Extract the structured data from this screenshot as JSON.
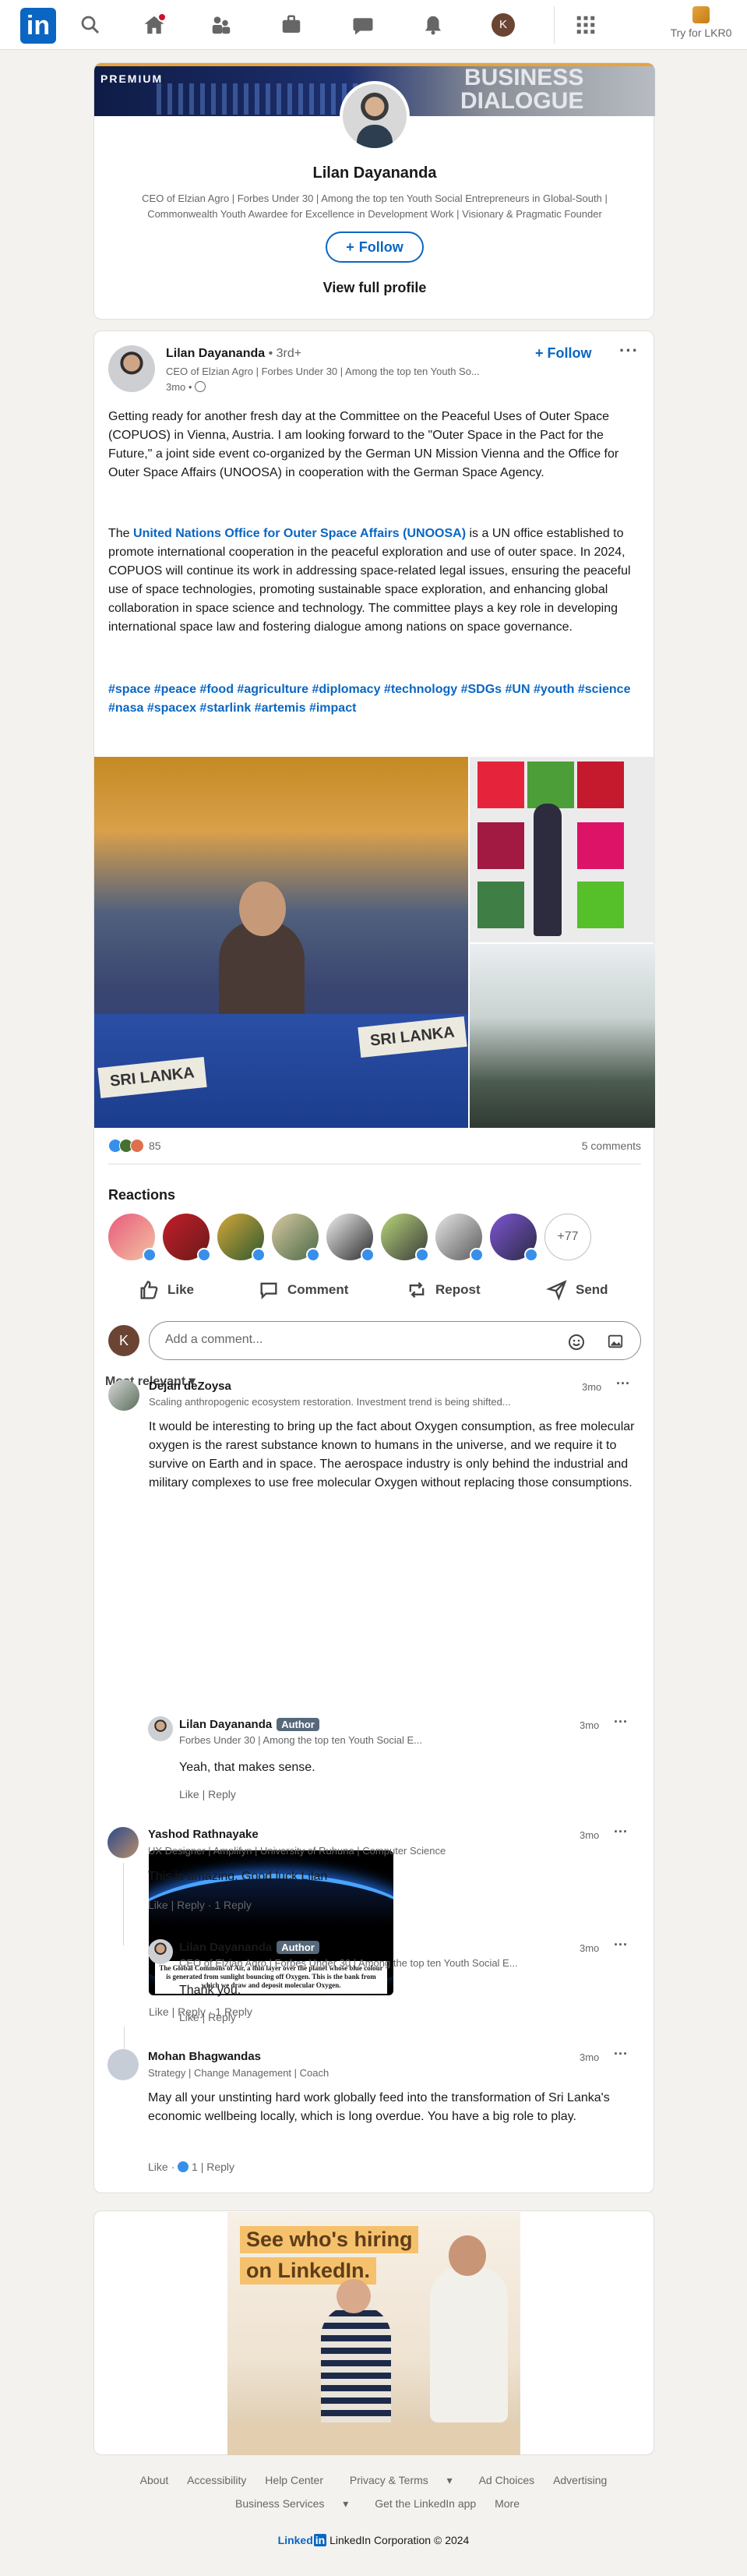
{
  "nav": {
    "logo": "in",
    "try_premium": "Try for LKR0",
    "me_initial": "K"
  },
  "profile_card": {
    "premium_label": "PREMIUM",
    "banner_text_1": "BUSINESS",
    "banner_text_2": "DIALOGUE",
    "name": "Lilan Dayananda",
    "headline": "CEO of Elzian Agro | Forbes Under 30 | Among the top ten Youth Social Entrepreneurs in Global-South | Commonwealth Youth Awardee for Excellence in Development Work | Visionary & Pragmatic Founder",
    "follow": "Follow",
    "view_profile": "View full profile"
  },
  "post": {
    "author": "Lilan Dayananda",
    "degree": "• 3rd+",
    "headline": "CEO of Elzian Agro | Forbes Under 30 | Among the top ten Youth So...",
    "time": "3mo •",
    "follow": "Follow",
    "para1": "Getting ready for another fresh day at the Committee on the Peaceful Uses of Outer Space (COPUOS) in Vienna, Austria. I am looking forward to the \"Outer Space in the Pact for the Future,\" a joint side event co-organized by the German UN Mission Vienna and the Office for Outer Space Affairs (UNOOSA) in cooperation with the German Space Agency.",
    "para2_pre": "The ",
    "para2_link": "United Nations Office for Outer Space Affairs (UNOOSA)",
    "para2_post": " is a UN office established to promote international cooperation in the peaceful exploration and use of outer space. In 2024, COPUOS will continue its work in addressing space-related legal issues, ensuring the peaceful use of space technologies, promoting sustainable space exploration, and enhancing global collaboration in space science and technology. The committee plays a key role in developing international space law and fostering dialogue among nations on space governance.",
    "hashtags": "#space #peace #food #agriculture #diplomacy #technology #SDGs #UN #youth #science #nasa #spacex #starlink #artemis #impact",
    "nameplate_1": "SRI LANKA",
    "nameplate_2": "SRI LANKA",
    "reaction_count": "85",
    "comments_count": "5 comments",
    "reactions_title": "Reactions",
    "more_reactors": "+77",
    "actions": {
      "like": "Like",
      "comment": "Comment",
      "repost": "Repost",
      "send": "Send"
    },
    "comment_placeholder": "Add a comment...",
    "sort": "Most relevant"
  },
  "comments": [
    {
      "name": "Dejan deZoysa",
      "sub": "Scaling anthropogenic ecosystem restoration. Investment trend is being shifted...",
      "time": "3mo",
      "text": "It would be interesting to bring up the fact about Oxygen consumption, as free molecular oxygen is the rarest substance known to humans in the universe, and we require it to survive on Earth and in space. The aerospace industry is only behind the industrial and military complexes to use free molecular Oxygen without replacing those consumptions.",
      "image_caption": "The Global Commons of Air, a thin layer over the planet whose blue colour is generated from sunlight bouncing off Oxygen. This is the bank from which we draw and deposit molecular Oxygen.",
      "like": "Like",
      "reply": "Reply",
      "replies": "1 Reply"
    },
    {
      "name": "Lilan Dayananda",
      "badge": "Author",
      "sub": "Forbes Under 30 | Among the top ten Youth Social E...",
      "time": "3mo",
      "text": "Yeah, that makes sense.",
      "like": "Like",
      "reply": "Reply"
    },
    {
      "name": "Yashod Rathnayake",
      "sub": "UX Designer | Amplifyn | University of Ruhuna | Computer Science",
      "time": "3mo",
      "text": "This is amazing. Good luck Lilan",
      "like": "Like",
      "reply": "Reply",
      "replies": "1 Reply"
    },
    {
      "name": "Lilan Dayananda",
      "badge": "Author",
      "sub": "CEO of Elzian Agro | Forbes Under 30 | Among the top ten Youth Social E...",
      "time": "3mo",
      "text": "Thank you.",
      "like": "Like",
      "reply": "Reply"
    },
    {
      "name": "Mohan Bhagwandas",
      "sub": "Strategy | Change Management | Coach",
      "time": "3mo",
      "text": "May all your unstinting hard work globally feed into the transformation of Sri Lanka's economic wellbeing locally, which is long overdue. You have a big role to play.",
      "like": "Like",
      "like_count": "1",
      "reply": "Reply"
    }
  ],
  "ad": {
    "line1": "See who's hiring",
    "line2": "on LinkedIn."
  },
  "footer": {
    "about": "About",
    "accessibility": "Accessibility",
    "help": "Help Center",
    "privacy": "Privacy & Terms",
    "ad_choices": "Ad Choices",
    "advertising": "Advertising",
    "business": "Business Services",
    "app": "Get the LinkedIn app",
    "more": "More",
    "brand_word": "Linked",
    "brand_in": "in",
    "copyright": "LinkedIn Corporation © 2024"
  }
}
